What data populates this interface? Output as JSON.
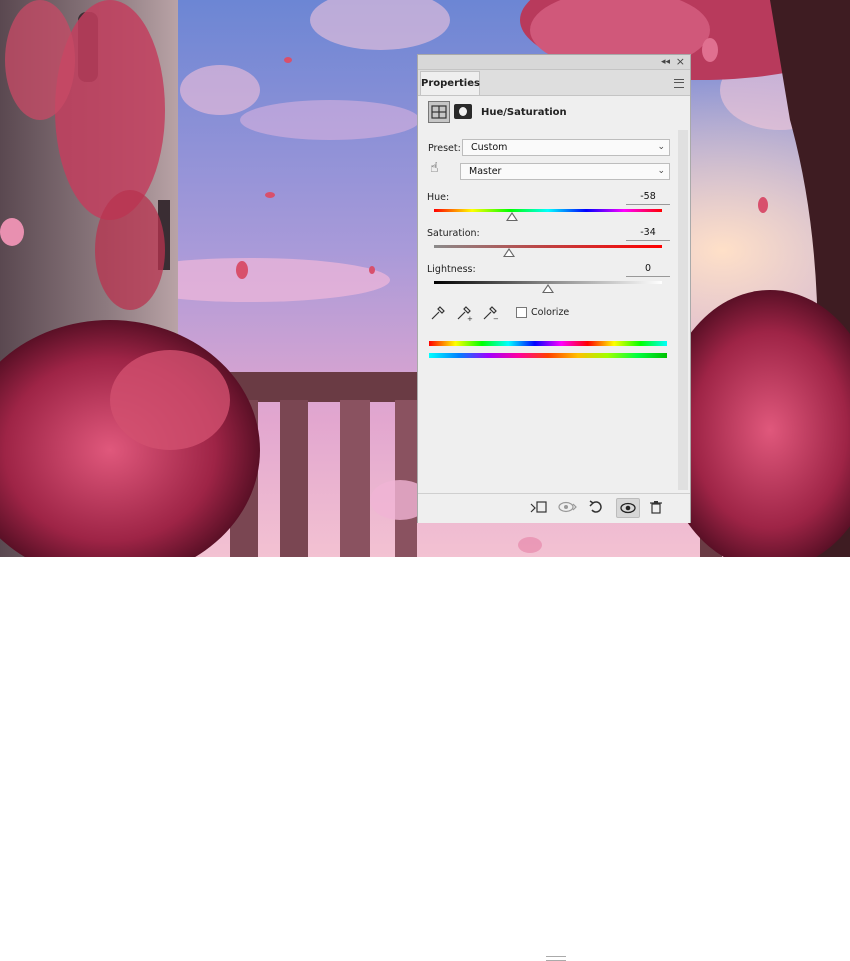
{
  "panel": {
    "tab": "Properties",
    "adjustment_title": "Hue/Saturation",
    "preset_label": "Preset:",
    "preset_value": "Custom",
    "channel_value": "Master",
    "hue_label": "Hue:",
    "hue_value": "-58",
    "hue_slider_fraction": 0.34,
    "saturation_label": "Saturation:",
    "saturation_value": "-34",
    "saturation_slider_fraction": 0.33,
    "lightness_label": "Lightness:",
    "lightness_value": "0",
    "lightness_slider_fraction": 0.5,
    "colorize_label": "Colorize",
    "colorize_checked": false,
    "icons": {
      "collapse": "double-chevron-left-icon",
      "close": "close-icon",
      "menu": "panel-menu-icon",
      "hand": "targeted-adjustment-hand-icon",
      "droppers": [
        "eyedropper-icon",
        "eyedropper-add-icon",
        "eyedropper-subtract-icon"
      ],
      "footer": [
        "clip-to-layer-icon",
        "view-previous-state-icon",
        "reset-icon",
        "visibility-eye-icon",
        "delete-trash-icon"
      ]
    }
  },
  "colors": {
    "panel_bg": "#efefef",
    "sky_top": "#6c86d4",
    "sky_pink": "#e2a6cf",
    "foliage": "#c73a5c",
    "hue_spectrum": [
      "#ff0000",
      "#ffff00",
      "#00ff00",
      "#00ffff",
      "#0000ff",
      "#ff00ff",
      "#ff0000"
    ]
  }
}
